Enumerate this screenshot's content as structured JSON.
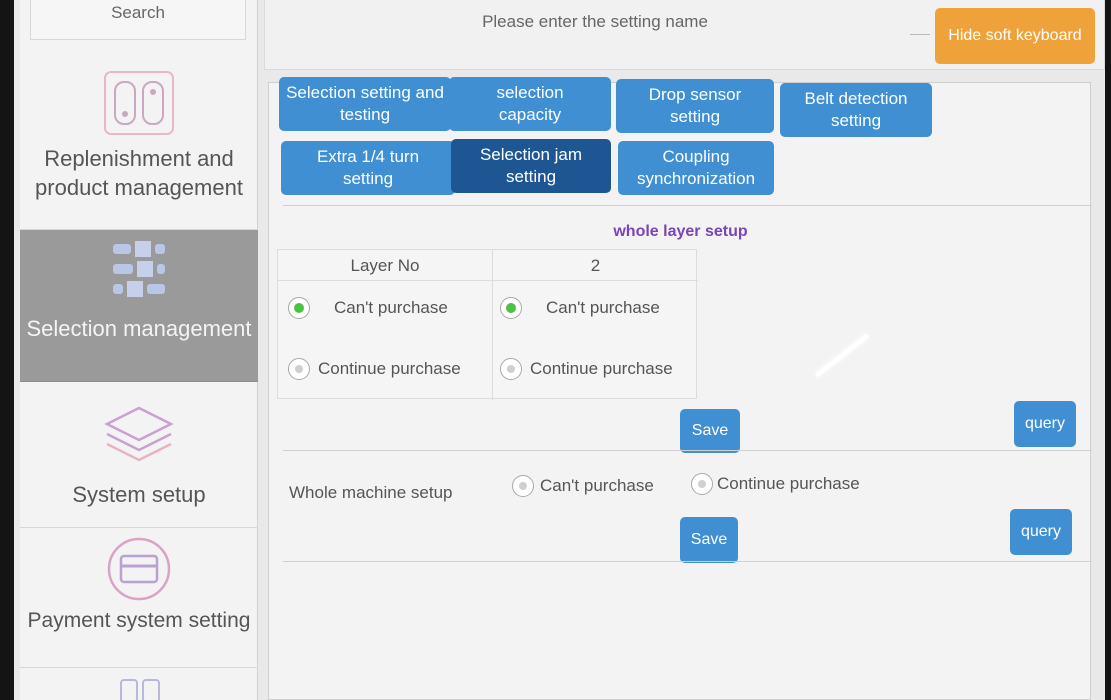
{
  "sidebar": {
    "search_label": "Search",
    "items": [
      {
        "label": "Replenishment and product management",
        "icon": "replenishment-icon"
      },
      {
        "label": "Selection management",
        "icon": "selection-icon",
        "active": true
      },
      {
        "label": "System setup",
        "icon": "layers-icon"
      },
      {
        "label": "Payment system setting",
        "icon": "payment-card-icon"
      }
    ]
  },
  "topbar": {
    "search_placeholder": "Please enter the setting name",
    "hide_keyboard_label": "Hide soft keyboard"
  },
  "tabs": [
    {
      "label": "Selection setting and testing"
    },
    {
      "label": "selection capacity"
    },
    {
      "label": "Drop sensor setting"
    },
    {
      "label": "Belt detection setting"
    },
    {
      "label": "Extra 1/4 turn setting"
    },
    {
      "label": "Selection jam setting",
      "active": true
    },
    {
      "label": "Coupling synchronization"
    }
  ],
  "whole_layer": {
    "title": "whole layer setup",
    "col_header": "Layer No",
    "layer_number": "2",
    "left": {
      "cant": "Can't purchase",
      "cont": "Continue purchase",
      "selected": "cant"
    },
    "right": {
      "cant": "Can't purchase",
      "cont": "Continue purchase",
      "selected": "cant"
    },
    "save_label": "Save",
    "query_label": "query"
  },
  "whole_machine": {
    "label": "Whole machine setup",
    "cant": "Can't purchase",
    "cont": "Continue purchase",
    "selected": "none",
    "save_label": "Save",
    "query_label": "query"
  },
  "colors": {
    "accent_blue": "#3f8fd2",
    "active_tab": "#1e5694",
    "orange_button": "#f0a23a",
    "radio_selected": "#4fc245",
    "section_title": "#7a45b5",
    "sidebar_active": "#9a9a9a"
  }
}
